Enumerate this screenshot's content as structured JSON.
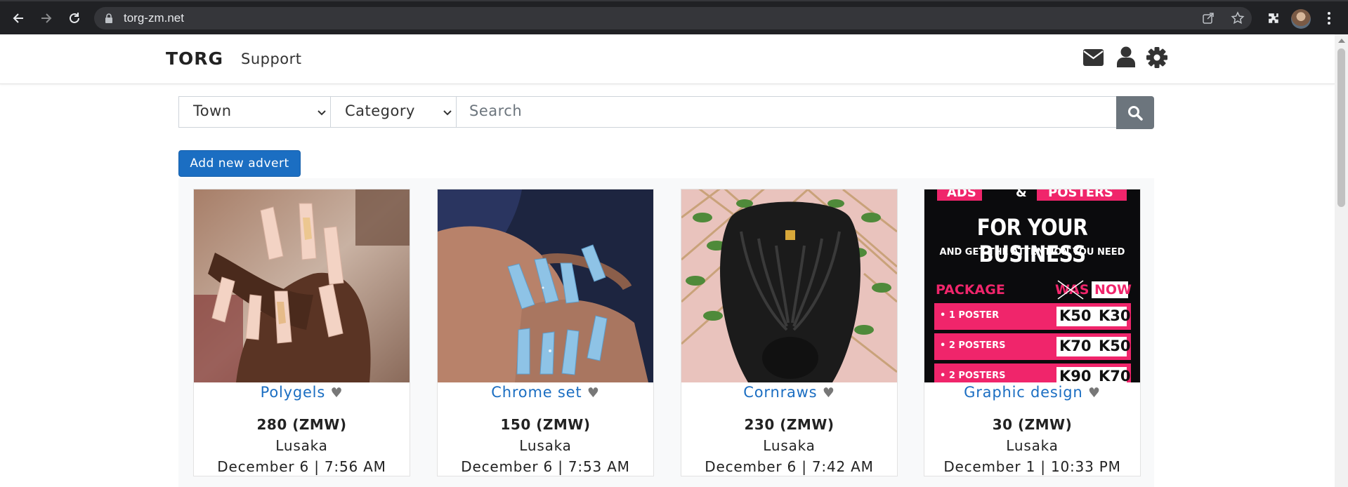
{
  "browser": {
    "url": "torg-zm.net"
  },
  "nav": {
    "brand": "TORG",
    "support_label": "Support"
  },
  "search": {
    "town_label": "Town",
    "category_label": "Category",
    "placeholder": "Search"
  },
  "add_advert_label": "Add new advert",
  "listings": [
    {
      "title": "Polygels",
      "price": "280 (ZMW)",
      "town": "Lusaka",
      "date": "December 6 | 7:56 AM"
    },
    {
      "title": "Chrome set",
      "price": "150 (ZMW)",
      "town": "Lusaka",
      "date": "December 6 | 7:53 AM"
    },
    {
      "title": "Cornraws",
      "price": "230 (ZMW)",
      "town": "Lusaka",
      "date": "December 6 | 7:42 AM"
    },
    {
      "title": "Graphic design",
      "price": "30 (ZMW)",
      "town": "Lusaka",
      "date": "December 1 | 10:33 PM"
    }
  ],
  "poster": {
    "top_left": "ADS",
    "top_amp": "&",
    "top_right": "POSTERS",
    "headline": "FOR YOUR BUSINESS",
    "subline": "AND GET THE ATTENTION YOU NEED",
    "package_label": "PACKAGE",
    "was_label": "WAS",
    "now_label": "NOW",
    "rows": [
      {
        "label": "• 1 POSTER",
        "was": "K50",
        "now": "K30"
      },
      {
        "label": "• 2 POSTERS",
        "was": "K70",
        "now": "K50"
      },
      {
        "label": "• 2 POSTERS",
        "was": "K90",
        "now": "K70"
      }
    ]
  },
  "colors": {
    "primary": "#1b6ec2",
    "search_button": "#6c757d",
    "poster_pink": "#f0256b"
  }
}
